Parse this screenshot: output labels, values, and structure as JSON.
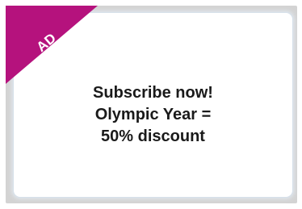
{
  "ad": {
    "badge_label": "AD",
    "ribbon_color": "#b5127d",
    "message_lines": [
      "Subscribe now!",
      "Olympic Year =",
      "50% discount"
    ]
  }
}
